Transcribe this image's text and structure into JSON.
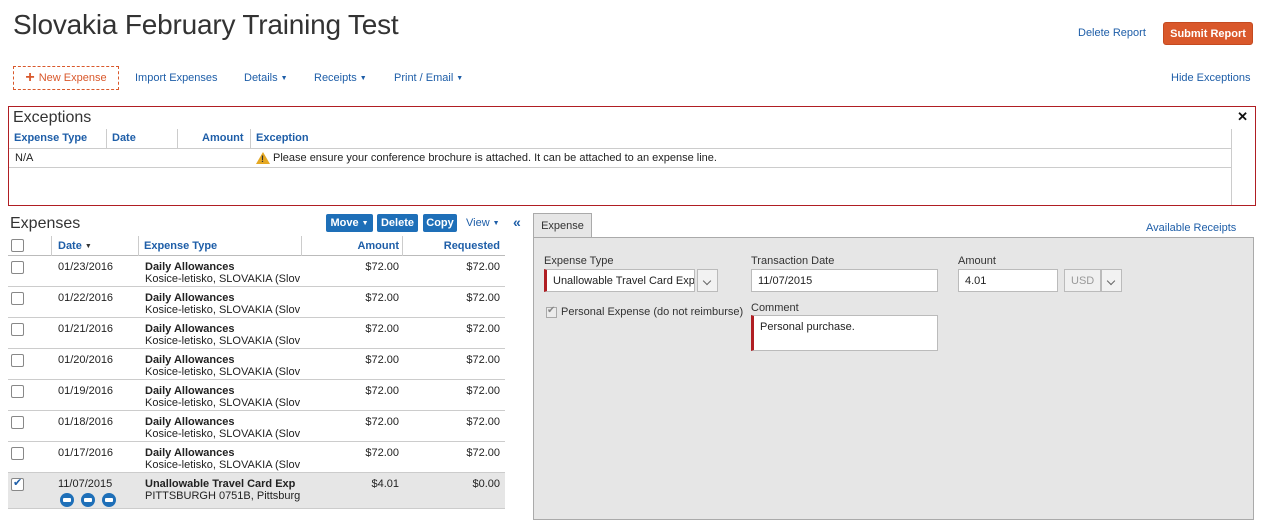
{
  "header": {
    "title": "Slovakia February Training Test",
    "delete_report": "Delete Report",
    "submit_report": "Submit Report"
  },
  "toolbar": {
    "new_expense": "New Expense",
    "import_expenses": "Import Expenses",
    "details": "Details",
    "receipts": "Receipts",
    "print_email": "Print / Email",
    "hide_exceptions": "Hide Exceptions"
  },
  "exceptions": {
    "title": "Exceptions",
    "columns": [
      "Expense Type",
      "Date",
      "Amount",
      "Exception"
    ],
    "rows": [
      {
        "expense_type": "N/A",
        "date": "",
        "amount": "",
        "exception": "Please ensure your conference brochure is attached. It can be attached to an expense line."
      }
    ]
  },
  "expenses": {
    "title": "Expenses",
    "buttons": {
      "move": "Move",
      "delete": "Delete",
      "copy": "Copy",
      "view": "View"
    },
    "columns": {
      "date": "Date",
      "expense_type": "Expense Type",
      "amount": "Amount",
      "requested": "Requested"
    },
    "rows": [
      {
        "date": "01/23/2016",
        "type": "Daily Allowances",
        "location": "Kosice-letisko, SLOVAKIA (Slov",
        "amount": "$72.00",
        "requested": "$72.00",
        "checked": false
      },
      {
        "date": "01/22/2016",
        "type": "Daily Allowances",
        "location": "Kosice-letisko, SLOVAKIA (Slov",
        "amount": "$72.00",
        "requested": "$72.00",
        "checked": false
      },
      {
        "date": "01/21/2016",
        "type": "Daily Allowances",
        "location": "Kosice-letisko, SLOVAKIA (Slov",
        "amount": "$72.00",
        "requested": "$72.00",
        "checked": false
      },
      {
        "date": "01/20/2016",
        "type": "Daily Allowances",
        "location": "Kosice-letisko, SLOVAKIA (Slov",
        "amount": "$72.00",
        "requested": "$72.00",
        "checked": false
      },
      {
        "date": "01/19/2016",
        "type": "Daily Allowances",
        "location": "Kosice-letisko, SLOVAKIA (Slov",
        "amount": "$72.00",
        "requested": "$72.00",
        "checked": false
      },
      {
        "date": "01/18/2016",
        "type": "Daily Allowances",
        "location": "Kosice-letisko, SLOVAKIA (Slov",
        "amount": "$72.00",
        "requested": "$72.00",
        "checked": false
      },
      {
        "date": "01/17/2016",
        "type": "Daily Allowances",
        "location": "Kosice-letisko, SLOVAKIA (Slov",
        "amount": "$72.00",
        "requested": "$72.00",
        "checked": false
      },
      {
        "date": "11/07/2015",
        "type": "Unallowable Travel Card Exp",
        "location": "PITTSBURGH 0751B, Pittsburg",
        "amount": "$4.01",
        "requested": "$0.00",
        "checked": true
      }
    ],
    "row_icons": [
      "card-icon",
      "receipt-icon",
      "comment-icon"
    ]
  },
  "detail": {
    "tab": "Expense",
    "available_receipts": "Available Receipts",
    "expense_type_label": "Expense Type",
    "expense_type_value": "Unallowable Travel Card Exp",
    "transaction_date_label": "Transaction Date",
    "transaction_date_value": "11/07/2015",
    "amount_label": "Amount",
    "amount_value": "4.01",
    "currency_value": "USD",
    "personal_expense_label": "Personal Expense (do not reimburse)",
    "comment_label": "Comment",
    "comment_value": "Personal purchase."
  },
  "colors": {
    "accent_orange": "#d9582b",
    "link_blue": "#1e5ea8",
    "button_blue": "#1e6fb8",
    "exception_red": "#b01e23"
  }
}
